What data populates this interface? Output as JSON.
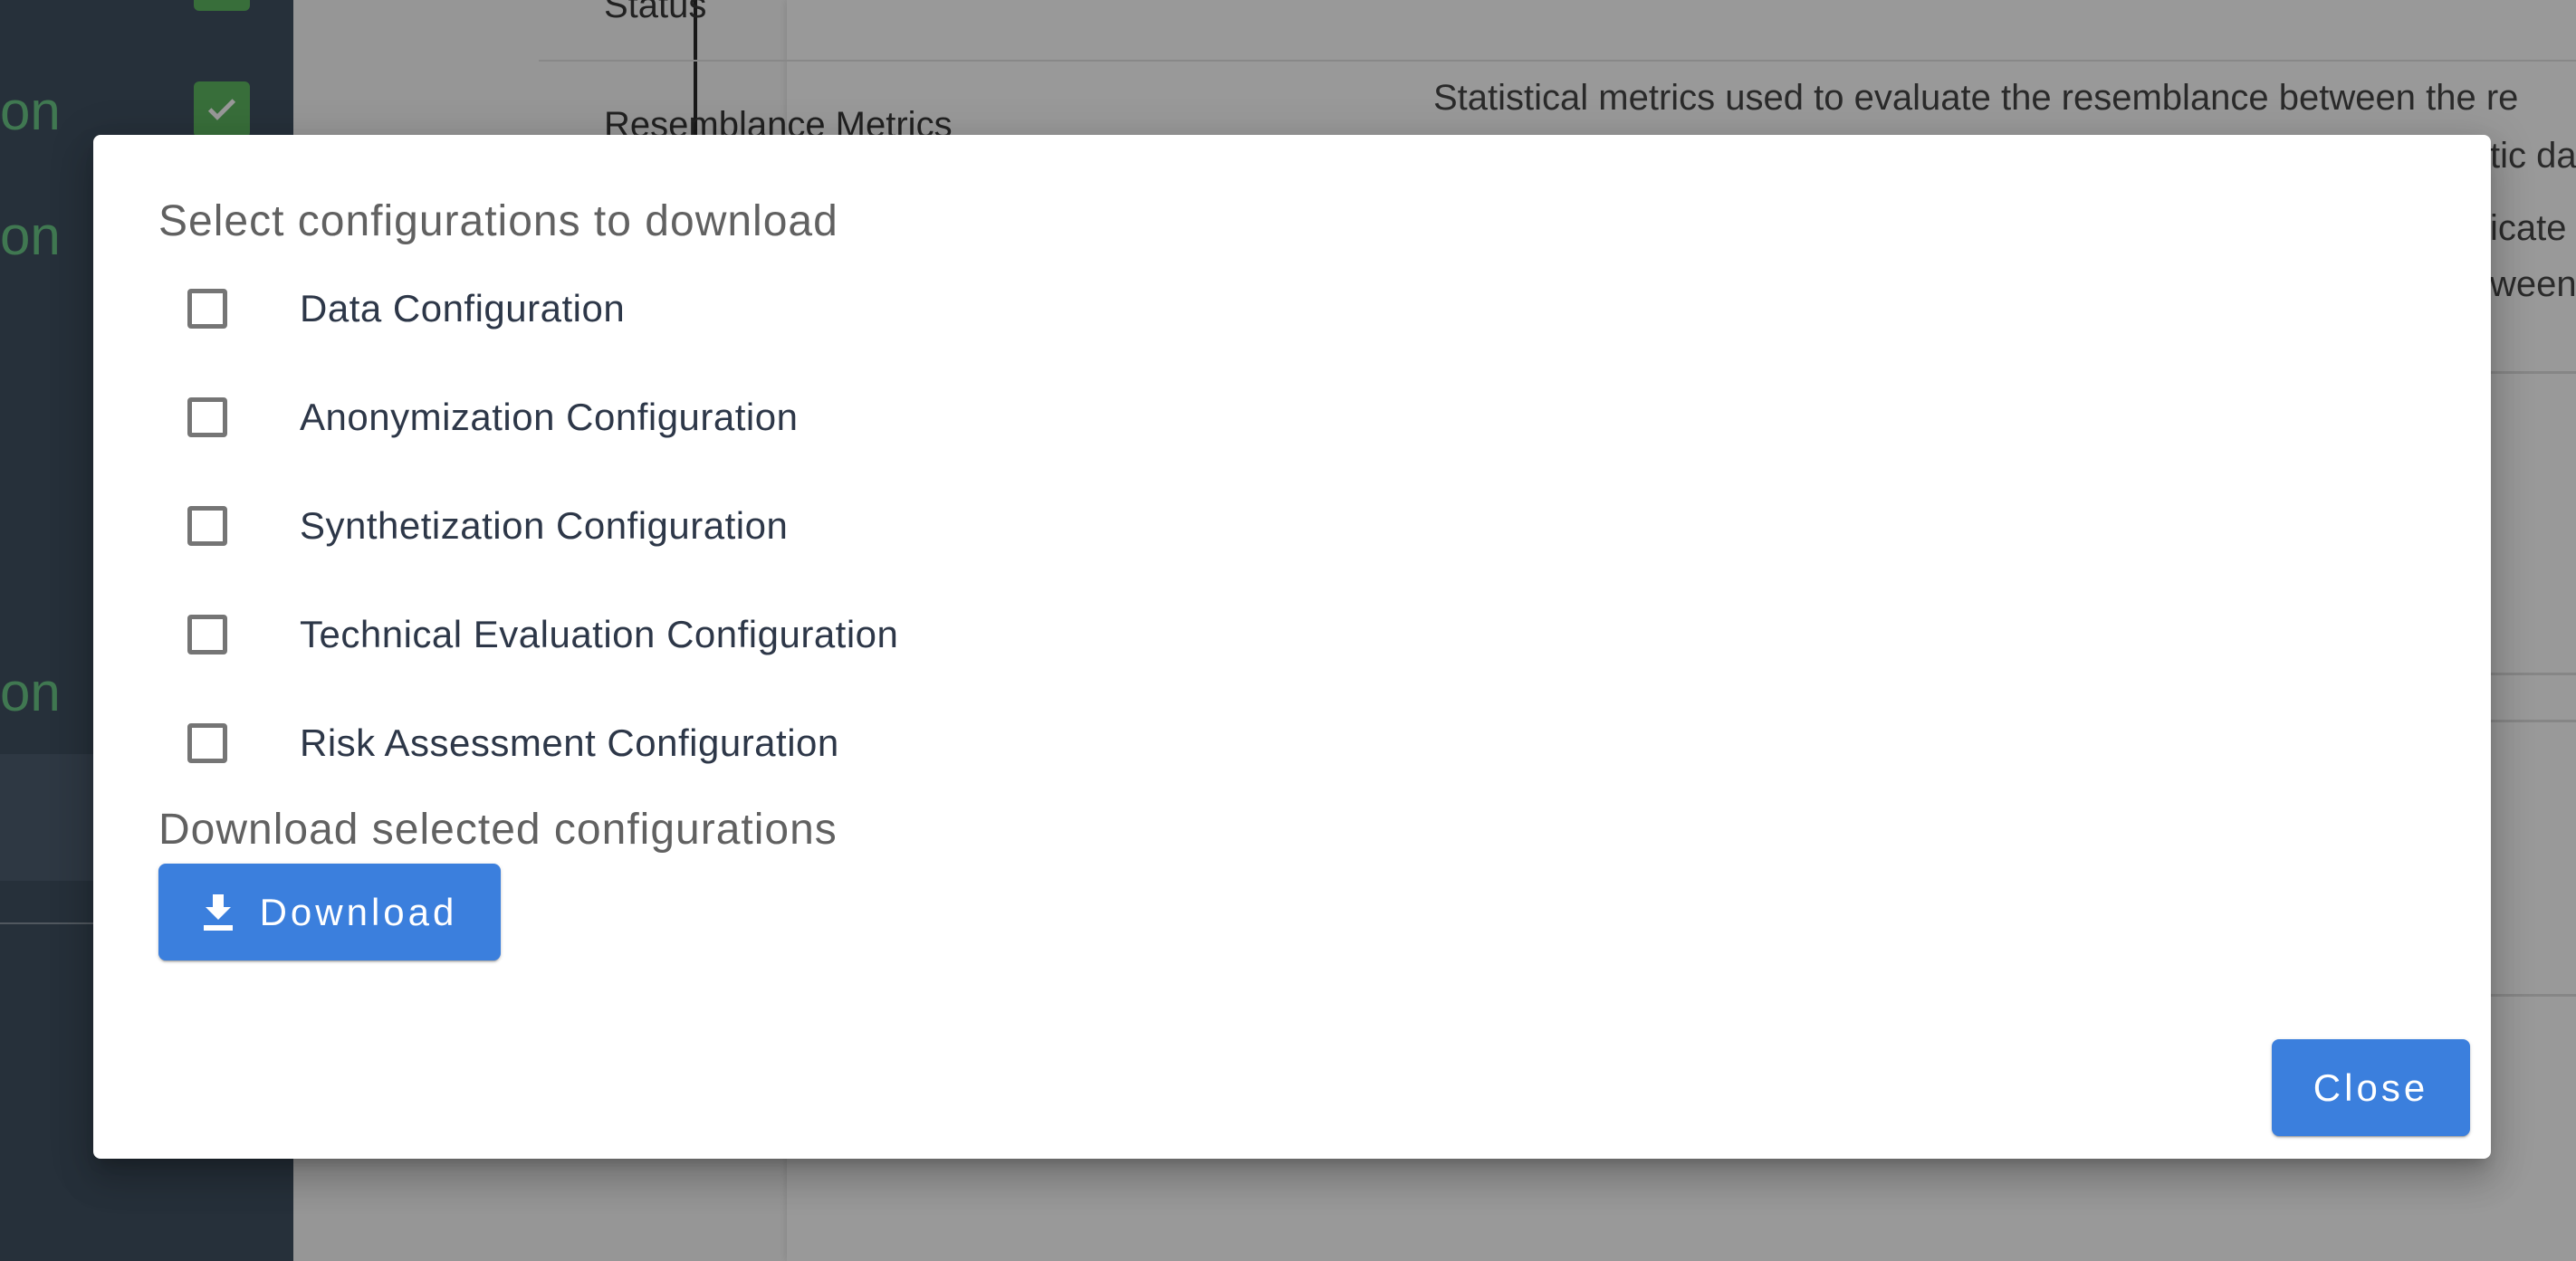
{
  "background": {
    "sidebar": {
      "items": [
        {
          "label": "on"
        },
        {
          "label": "on"
        },
        {
          "label": "on"
        }
      ]
    },
    "table": {
      "rows": [
        {
          "name": "Status",
          "description": ""
        },
        {
          "name": "Resemblance Metrics",
          "description": "Statistical metrics used to evaluate the resemblance between the re"
        }
      ],
      "partial_lines": [
        "tic da",
        "icate",
        "ween"
      ]
    }
  },
  "dialog": {
    "select_title": "Select configurations to download",
    "options": [
      {
        "label": "Data Configuration",
        "checked": false
      },
      {
        "label": "Anonymization Configuration",
        "checked": false
      },
      {
        "label": "Synthetization Configuration",
        "checked": false
      },
      {
        "label": "Technical Evaluation Configuration",
        "checked": false
      },
      {
        "label": "Risk Assessment Configuration",
        "checked": false
      }
    ],
    "download_title": "Download selected configurations",
    "download_button": {
      "label": "Download",
      "icon": "download-icon"
    },
    "close_button": {
      "label": "Close"
    }
  },
  "colors": {
    "primary": "#3b7fdd",
    "sidebar_bg": "#2c3e50",
    "sidebar_text": "#5cc27a",
    "check_green": "#4caf50"
  }
}
